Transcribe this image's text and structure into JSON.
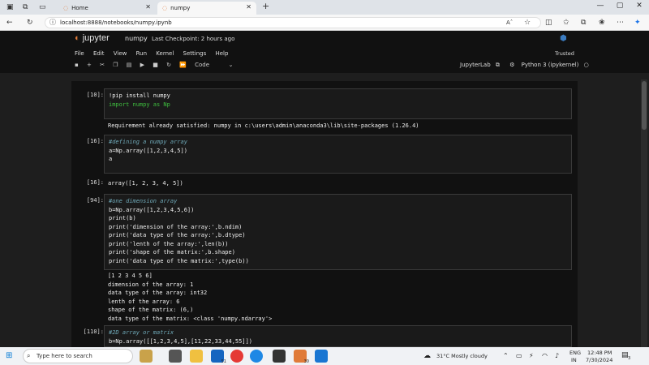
{
  "browser": {
    "tabs": [
      {
        "label": "Home"
      },
      {
        "label": "numpy"
      }
    ],
    "url": "localhost:8888/notebooks/numpy.ipynb",
    "new_tab": "+"
  },
  "jupyter": {
    "logo_text": "jupyter",
    "notebook_name": "numpy",
    "checkpoint": "Last Checkpoint: 2 hours ago",
    "menu": [
      "File",
      "Edit",
      "View",
      "Run",
      "Kernel",
      "Settings",
      "Help"
    ],
    "trusted": "Trusted",
    "cell_type": "Code",
    "jupyterlab": "JupyterLab",
    "kernel": "Python 3 (ipykernel)"
  },
  "cells": [
    {
      "prompt": "[10]:",
      "lines": [
        "!pip install numpy",
        "import numpy as Np"
      ],
      "output": [
        "Requirement already satisfied: numpy in c:\\users\\admin\\anaconda3\\lib\\site-packages (1.26.4)"
      ]
    },
    {
      "prompt": "[16]:",
      "lines": [
        "#defining a numpy array",
        "a=Np.array([1,2,3,4,5])",
        "a"
      ],
      "out_prompt": "[16]:",
      "output": [
        "array([1, 2, 3, 4, 5])"
      ]
    },
    {
      "prompt": "[94]:",
      "lines": [
        "#one dimension array",
        "b=Np.array([1,2,3,4,5,6])",
        "print(b)",
        "print('dimension of the array:',b.ndim)",
        "print('data type of the array:',b.dtype)",
        "print('lenth of the array:',len(b))",
        "print('shape of the matrix:',b.shape)",
        "print('data type of the matrix:',type(b))"
      ],
      "output": [
        "[1 2 3 4 5 6]",
        "dimension of the array: 1",
        "data type of the array: int32",
        "lenth of the array: 6",
        "shape of the matrix: (6,)",
        "data type of the matrix: <class 'numpy.ndarray'>"
      ]
    },
    {
      "prompt": "[110]:",
      "lines": [
        "#2D array or matrix",
        "b=Np.array([[1,2,3,4,5],[11,22,33,44,55]])"
      ]
    }
  ],
  "taskbar": {
    "search_placeholder": "Type here to search",
    "weather": "31°C  Mostly cloudy",
    "lang": "ENG",
    "region": "IN",
    "time": "12:48 PM",
    "date": "7/30/2024",
    "notif_count": "3",
    "badge_51": "51",
    "badge_30": "30"
  }
}
